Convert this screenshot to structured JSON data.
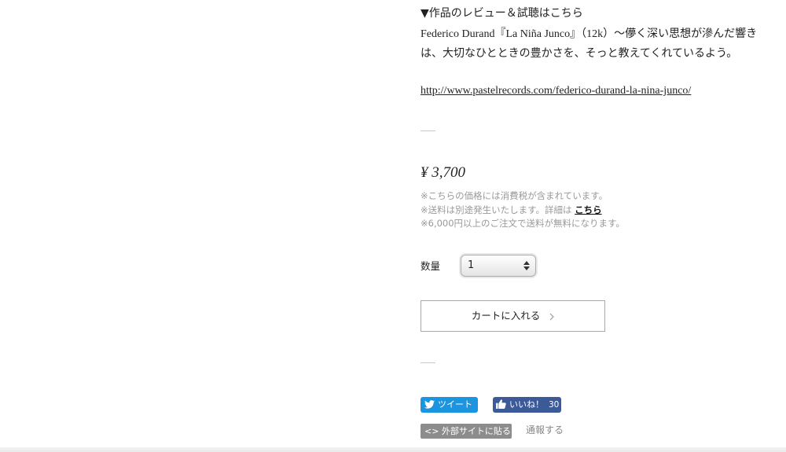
{
  "review": {
    "heading": "▼作品のレビュー＆試聴はこちら",
    "body": "Federico Durand『La Niña Junco』（12k）〜儚く深い思想が滲んだ響きは、大切なひとときの豊かさを、そっと教えてくれているよう。",
    "link": "http://www.pastelrecords.com/federico-durand-la-nina-junco/"
  },
  "product": {
    "price": "¥ 3,700",
    "note_tax": "※こちらの価格には消費税が含まれています。",
    "note_shipping_prefix": "※送料は別途発生いたします。詳細は",
    "note_shipping_link": "こちら",
    "note_free_shipping": "※6,000円以上のご注文で送料が無料になります。"
  },
  "quantity": {
    "label": "数量",
    "selected": "1"
  },
  "cart": {
    "button_label": "カートに入れる"
  },
  "social": {
    "tweet_label": "ツイート",
    "like_label": "いいね！",
    "like_count": "30",
    "embed_label": "<> 外部サイトに貼る",
    "report_label": "通報する"
  },
  "colors": {
    "tweet": "#1b95e0",
    "like": "#3d5a98",
    "embed": "#8c8c8c"
  }
}
